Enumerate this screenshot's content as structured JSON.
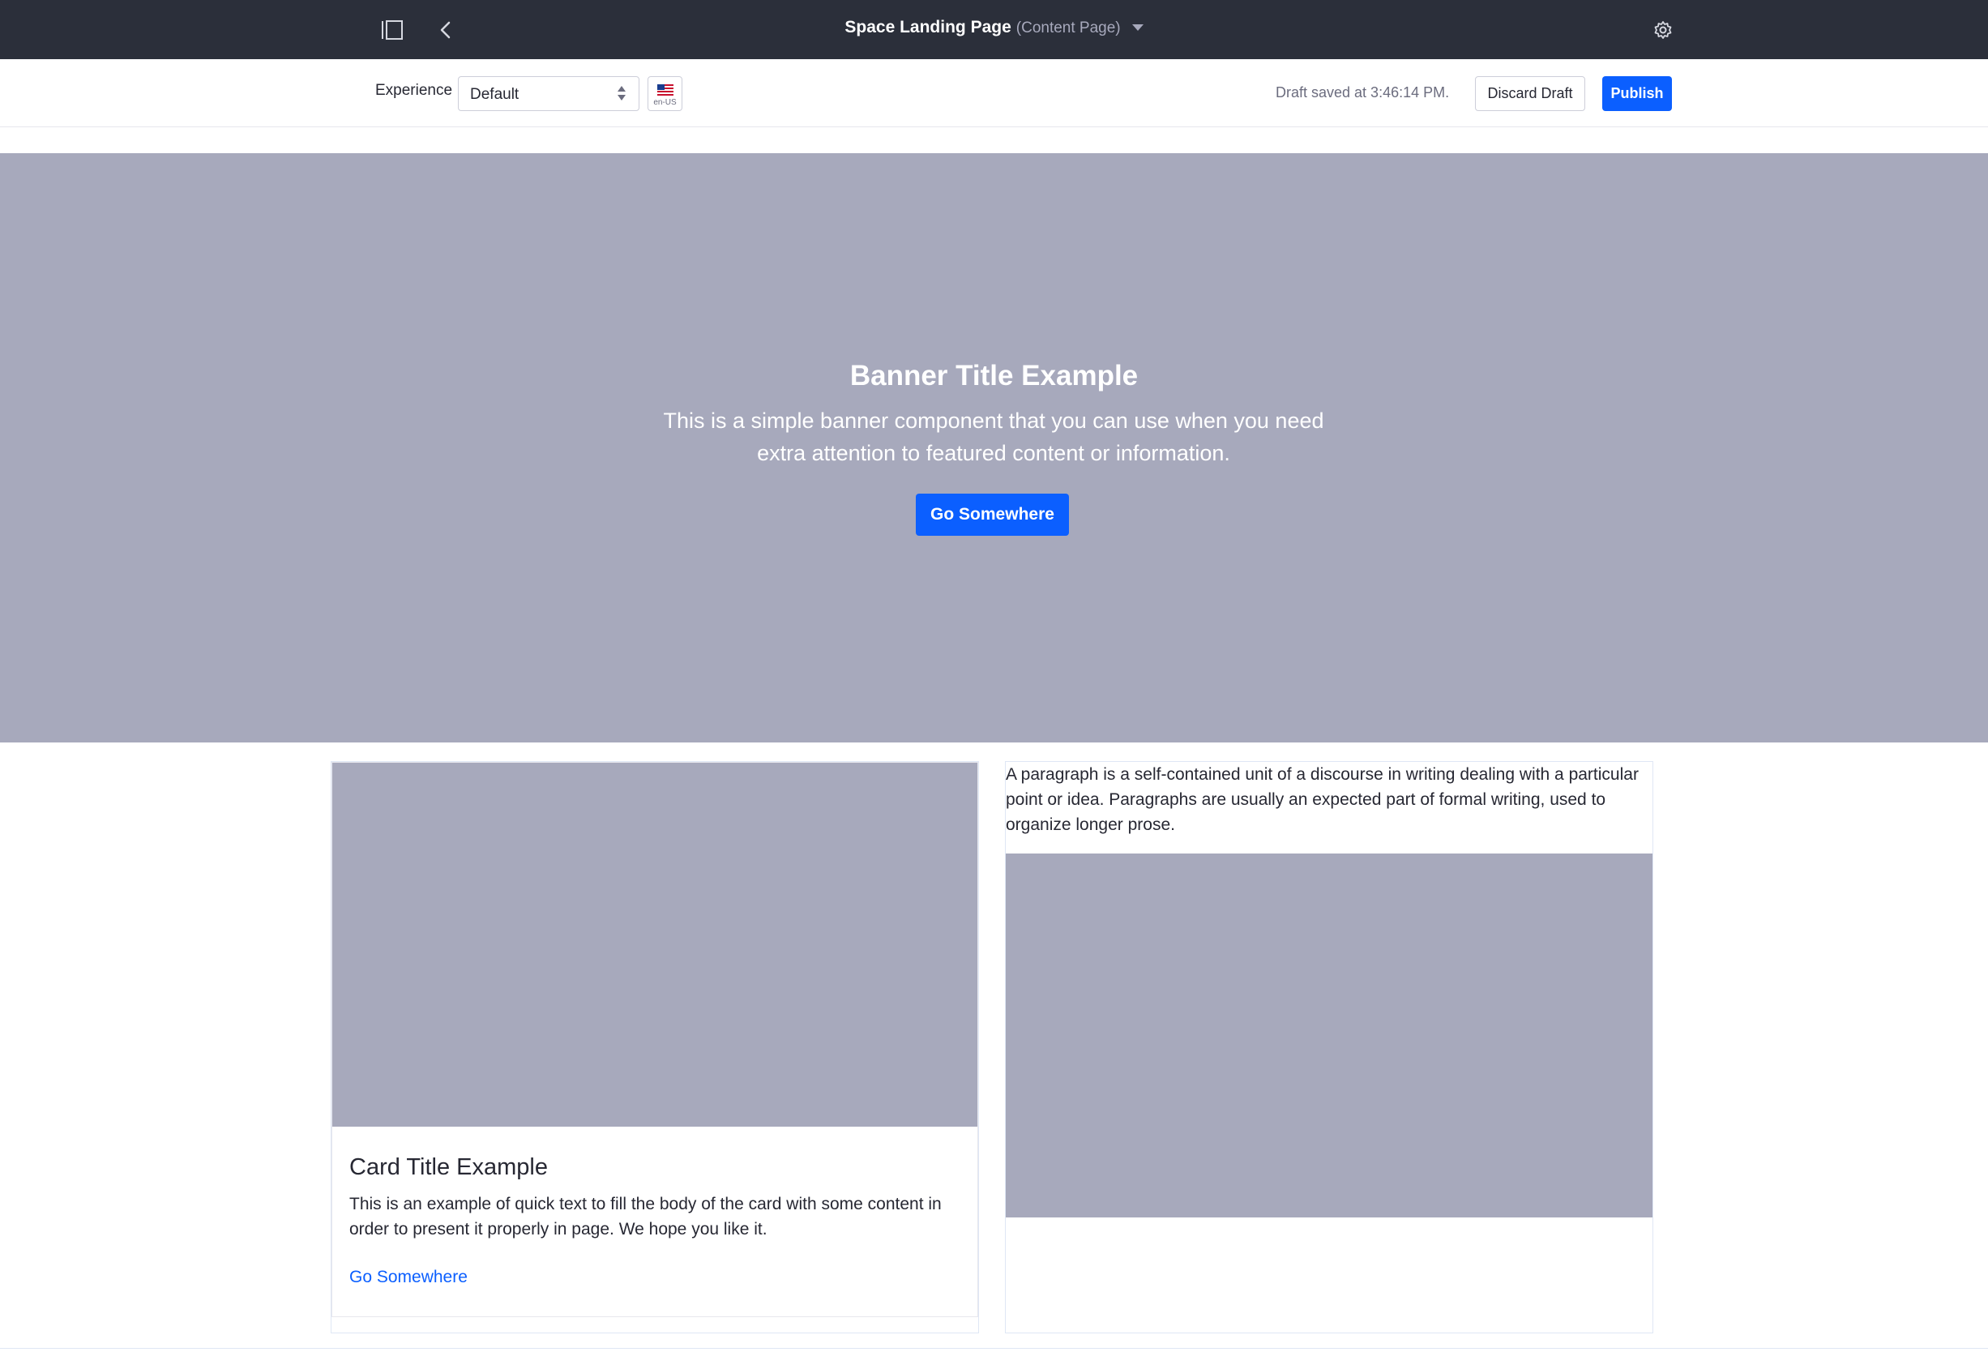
{
  "topbar": {
    "page_title": "Space Landing Page",
    "page_type": "(Content Page)",
    "icons": {
      "sidebar": "sidebar-toggle-icon",
      "back": "chevron-left-icon",
      "settings": "gear-icon"
    }
  },
  "toolbar": {
    "experience_label": "Experience",
    "experience_value": "Default",
    "locale_code": "en-US",
    "draft_status": "Draft saved at 3:46:14 PM.",
    "discard_label": "Discard Draft",
    "publish_label": "Publish"
  },
  "banner": {
    "title": "Banner Title Example",
    "text": "This is a simple banner component that you can use when you need extra attention to featured content or information.",
    "button_label": "Go Somewhere",
    "background": "#a7a9bc"
  },
  "card": {
    "title": "Card Title Example",
    "text": "This is an example of quick text to fill the body of the card with some content in order to present it properly in page. We hope you like it.",
    "link_label": "Go Somewhere"
  },
  "paragraph": {
    "text": "A paragraph is a self-contained unit of a discourse in writing dealing with a particular point or idea. Paragraphs are usually an expected part of formal writing, used to organize longer prose."
  },
  "colors": {
    "accent": "#0b5fff",
    "topbar": "#2b2f3a",
    "placeholder": "#a7a9bc"
  }
}
